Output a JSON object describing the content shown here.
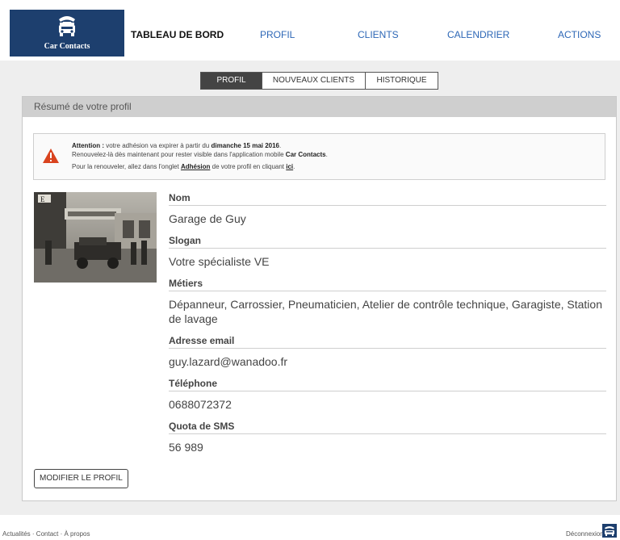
{
  "app": {
    "logo_text": "Car Contacts",
    "brand_color": "#1d3f6e",
    "link_color": "#2d67b6"
  },
  "nav": {
    "items": [
      {
        "label": "TABLEAU DE BORD",
        "active": true
      },
      {
        "label": "PROFIL",
        "active": false
      },
      {
        "label": "CLIENTS",
        "active": false
      },
      {
        "label": "CALENDRIER",
        "active": false
      },
      {
        "label": "ACTIONS",
        "active": false
      }
    ]
  },
  "subtabs": [
    {
      "label": "PROFIL",
      "active": true
    },
    {
      "label": "NOUVEAUX CLIENTS",
      "active": false
    },
    {
      "label": "HISTORIQUE",
      "active": false
    }
  ],
  "card": {
    "title": "Résumé de votre profil"
  },
  "alert": {
    "icon": "warning-icon",
    "lead": "Attention :",
    "text1": " votre adhésion va expirer à partir du ",
    "date": "dimanche 15 mai 2016",
    "text1_end": ".",
    "text2": "Renouvelez-là dès maintenant pour rester visible dans l'application mobile ",
    "app_name": "Car Contacts",
    "text2_end": ".",
    "text3": "Pour la renouveler, allez dans l'onglet ",
    "tab_name": "Adhésion",
    "text3_mid": " de votre profil en cliquant ",
    "link": "ici",
    "text3_end": "."
  },
  "profile": {
    "fields": [
      {
        "label": "Nom",
        "value": "Garage de Guy"
      },
      {
        "label": "Slogan",
        "value": "Votre spécialiste VE"
      },
      {
        "label": "Métiers",
        "value": "Dépanneur, Carrossier, Pneumaticien, Atelier de contrôle technique, Garagiste, Station de lavage"
      },
      {
        "label": "Adresse email",
        "value": "guy.lazard@wanadoo.fr"
      },
      {
        "label": "Téléphone",
        "value": "0688072372"
      },
      {
        "label": "Quota de SMS",
        "value": "56 989"
      }
    ],
    "modify_label": "MODIFIER LE PROFIL"
  },
  "footer": {
    "links": "Actualités · Contact · À propos",
    "logout": "Déconnexion"
  }
}
